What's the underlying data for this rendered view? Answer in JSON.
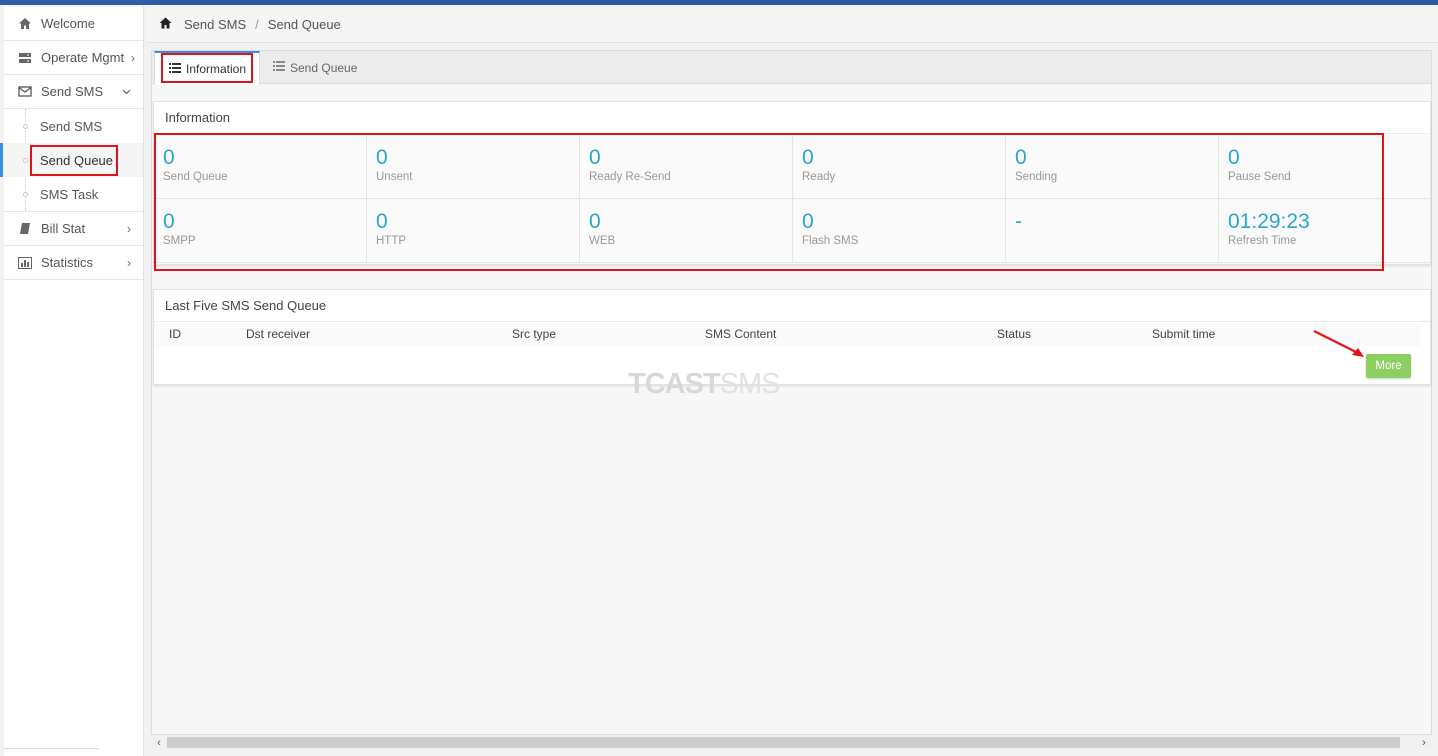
{
  "sidebar": {
    "items": [
      {
        "label": "Welcome",
        "icon": "home-icon"
      },
      {
        "label": "Operate Mgmt",
        "icon": "server-icon"
      },
      {
        "label": "Send SMS",
        "icon": "envelope-icon"
      },
      {
        "label": "Bill Stat",
        "icon": "book-icon"
      },
      {
        "label": "Statistics",
        "icon": "bar-chart-icon"
      }
    ],
    "submenu": [
      "Send SMS",
      "Send Queue",
      "SMS Task"
    ]
  },
  "breadcrumb": {
    "items": [
      "Send SMS",
      "Send Queue"
    ],
    "separator": "/"
  },
  "tabs": [
    {
      "label": "Information"
    },
    {
      "label": "Send Queue"
    }
  ],
  "info": {
    "title": "Information",
    "stats": [
      {
        "value": "0",
        "label": "Send Queue"
      },
      {
        "value": "0",
        "label": "Unsent"
      },
      {
        "value": "0",
        "label": "Ready Re-Send"
      },
      {
        "value": "0",
        "label": "Ready"
      },
      {
        "value": "0",
        "label": "Sending"
      },
      {
        "value": "0",
        "label": "Pause Send"
      },
      {
        "value": "0",
        "label": "SMPP"
      },
      {
        "value": "0",
        "label": "HTTP"
      },
      {
        "value": "0",
        "label": "WEB"
      },
      {
        "value": "0",
        "label": "Flash SMS"
      },
      {
        "value": "-",
        "label": ""
      },
      {
        "value": "01:29:23",
        "label": "Refresh Time"
      }
    ]
  },
  "queue": {
    "title": "Last Five SMS Send Queue",
    "columns": [
      "ID",
      "Dst receiver",
      "Src type",
      "SMS Content",
      "Status",
      "Submit time"
    ],
    "more_label": "More"
  },
  "watermark": {
    "part1": "TCAST",
    "part2": "SMS"
  },
  "colors": {
    "accent": "#2aa7c9",
    "annotation": "#e0131b",
    "button": "#8dcf60",
    "topbar": "#2c5ea8"
  }
}
